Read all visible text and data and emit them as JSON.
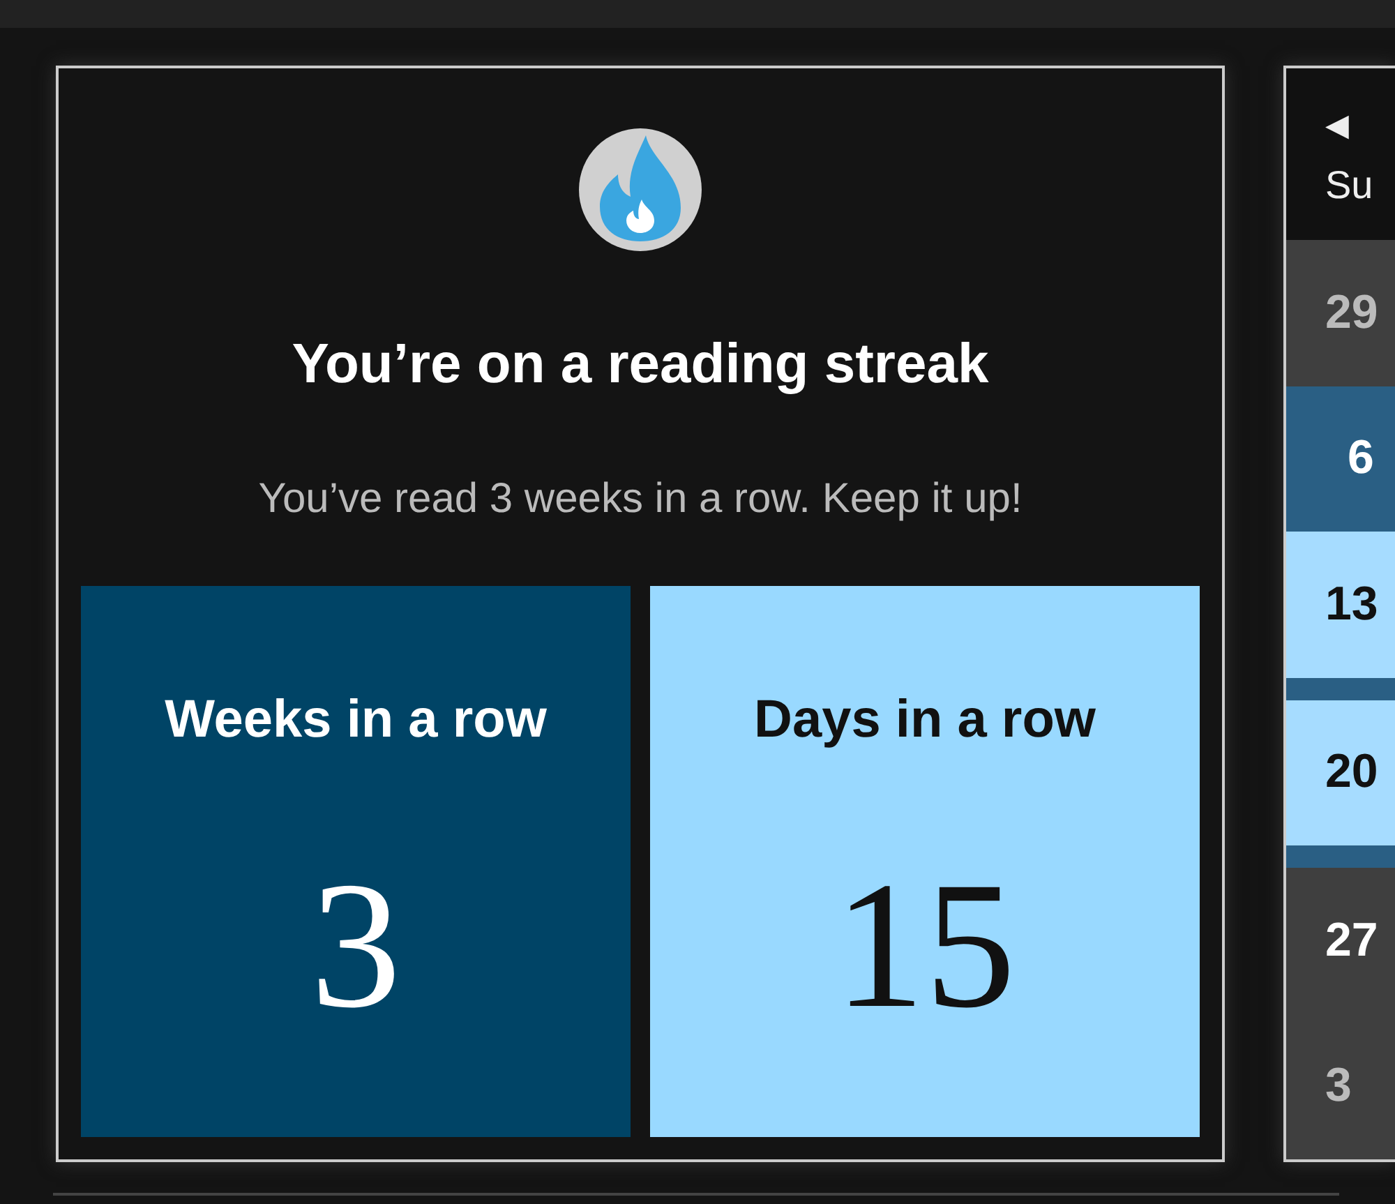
{
  "streak_card": {
    "title": "You’re on a reading streak",
    "message": "You’ve read 3 weeks in a row. Keep it up!",
    "stats": [
      {
        "label": "Weeks in a row",
        "value": "3",
        "kind": "weeks"
      },
      {
        "label": "Days in a row",
        "value": "15",
        "kind": "days"
      }
    ]
  },
  "calendar": {
    "prev_arrow": "◀",
    "weekday": "Su",
    "days": [
      {
        "day": "29",
        "kind": "outside"
      },
      {
        "day": "6",
        "kind": "week"
      },
      {
        "day": "13",
        "kind": "streak"
      },
      {
        "day": "20",
        "kind": "streak"
      },
      {
        "day": "27",
        "kind": "plain"
      },
      {
        "day": "3",
        "kind": "outside"
      }
    ]
  }
}
